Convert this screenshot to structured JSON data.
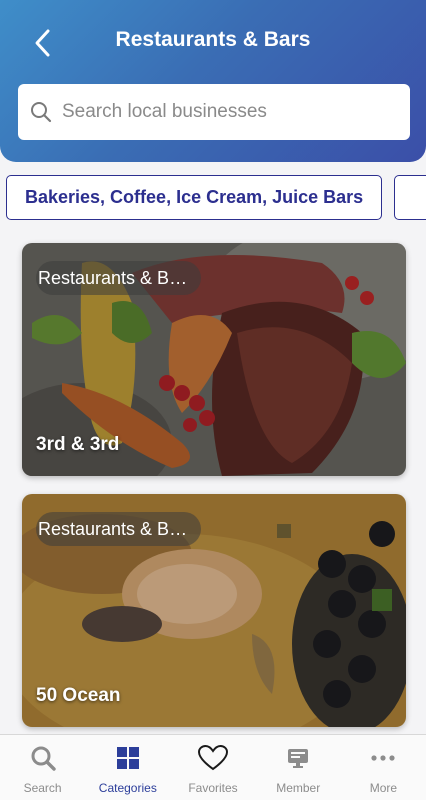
{
  "header": {
    "title": "Restaurants & Bars",
    "back_icon": "chevron-left-icon"
  },
  "search": {
    "placeholder": "Search local businesses",
    "value": "",
    "icon": "search-icon"
  },
  "category_chips": [
    {
      "label": "Bakeries, Coffee, Ice Cream, Juice Bars"
    },
    {
      "label": ""
    }
  ],
  "cards": [
    {
      "category": "Restaurants & B…",
      "name": "3rd & 3rd"
    },
    {
      "category": "Restaurants & B…",
      "name": "50 Ocean"
    }
  ],
  "tabbar": {
    "items": [
      {
        "label": "Search",
        "icon": "search-icon",
        "active": false
      },
      {
        "label": "Categories",
        "icon": "grid-icon",
        "active": true
      },
      {
        "label": "Favorites",
        "icon": "heart-icon",
        "active": false
      },
      {
        "label": "Member",
        "icon": "member-card-icon",
        "active": false
      },
      {
        "label": "More",
        "icon": "more-dots-icon",
        "active": false
      }
    ]
  },
  "colors": {
    "header_gradient_start": "#3f8ec9",
    "header_gradient_end": "#3b4fa8",
    "accent": "#2c3e9a",
    "chip_text": "#2c2f8f",
    "inactive": "#8c8c8c"
  }
}
